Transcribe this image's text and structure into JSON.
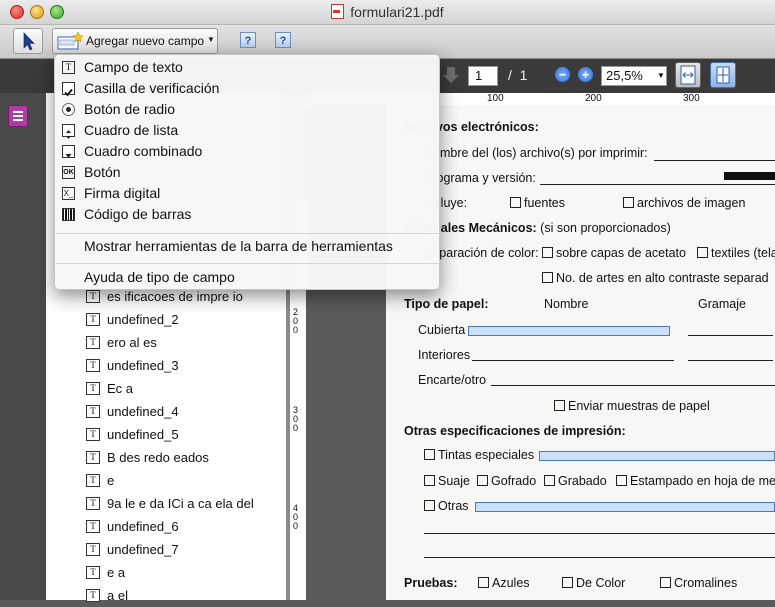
{
  "window": {
    "title": "formulari21.pdf"
  },
  "toolbar": {
    "add_field_label": "Agregar nuevo campo",
    "help1": "?",
    "help2": "?"
  },
  "nav": {
    "page": "1",
    "page_sep": "/",
    "page_total": "1",
    "zoom_out": "−",
    "zoom_in": "+",
    "zoom": "25,5%"
  },
  "menu": {
    "items": [
      {
        "label": "Campo de texto",
        "icon": "text-field-icon"
      },
      {
        "label": "Casilla de verificación",
        "icon": "checkbox-icon"
      },
      {
        "label": "Botón de radio",
        "icon": "radio-icon"
      },
      {
        "label": "Cuadro de lista",
        "icon": "list-box-icon"
      },
      {
        "label": "Cuadro combinado",
        "icon": "combo-box-icon"
      },
      {
        "label": "Botón",
        "icon": "button-icon"
      },
      {
        "label": "Firma digital",
        "icon": "signature-icon"
      },
      {
        "label": "Código de barras",
        "icon": "barcode-icon"
      }
    ],
    "show_toolbar_tools": "Mostrar herramientas de la barra de herramientas",
    "field_type_help": "Ayuda de tipo de campo",
    "ok_glyph": "OK",
    "sig_glyph": "X_"
  },
  "fields": [
    "es ificacoes de impre io",
    "undefined_2",
    "ero al es",
    "undefined_3",
    "Ec a",
    "undefined_4",
    "undefined_5",
    "B des redo eados",
    "e",
    "9a le e da ICi a ca ela del",
    "undefined_6",
    "undefined_7",
    "e a",
    "a el"
  ],
  "field_icon_glyph": "T",
  "ruler": {
    "h": [
      "100",
      "200",
      "300"
    ],
    "v": [
      "200",
      "300",
      "400"
    ]
  },
  "document": {
    "archivos": "Archivos electrónicos:",
    "nombre_archivo": "Nombre del (los) archivo(s) por imprimir:",
    "programa": "Programa y versión:",
    "incluye": "Incluye:",
    "fuentes": "fuentes",
    "archivos_imagen": "archivos de imagen",
    "mecanicos": "Originales Mecánicos:",
    "mecanicos_note": "(si son proporcionados)",
    "separacion": "Separación de color:",
    "acetato": "sobre capas de acetato",
    "textiles": "textiles (tela",
    "alto_contraste": "No. de artes en alto contraste  separad",
    "tipo_papel": "Tipo de papel:",
    "nombre": "Nombre",
    "gramaje": "Gramaje",
    "cubierta": "Cubierta",
    "interiores": "Interiores",
    "encarte": "Encarte/otro",
    "enviar_muestras": "Enviar muestras de papel",
    "otras_espec": "Otras especificaciones de impresión:",
    "tintas": "Tintas especiales",
    "suaje": "Suaje",
    "gofrado": "Gofrado",
    "grabado": "Grabado",
    "estampado": "Estampado en hoja de me",
    "otras": "Otras",
    "pruebas": "Pruebas:",
    "azules": "Azules",
    "de_color": "De Color",
    "cromalines": "Cromalines"
  }
}
